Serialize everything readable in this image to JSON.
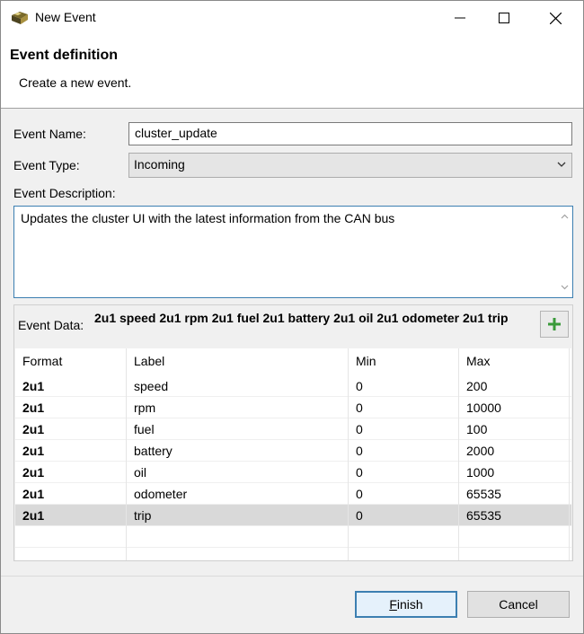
{
  "window": {
    "title": "New Event"
  },
  "banner": {
    "title": "Event definition",
    "description": "Create a new event."
  },
  "form": {
    "event_name_label": "Event Name:",
    "event_name_value": "cluster_update",
    "event_type_label": "Event Type:",
    "event_type_value": "Incoming",
    "event_description_label": "Event Description:",
    "event_description_value": "Updates the cluster UI with the latest information from the CAN bus"
  },
  "event_data": {
    "label": "Event Data:",
    "summary": "2u1 speed 2u1 rpm 2u1 fuel 2u1 battery 2u1 oil 2u1 odometer 2u1 trip",
    "columns": [
      "Format",
      "Label",
      "Min",
      "Max"
    ],
    "rows": [
      {
        "format": "2u1",
        "label": "speed",
        "min": "0",
        "max": "200"
      },
      {
        "format": "2u1",
        "label": "rpm",
        "min": "0",
        "max": "10000"
      },
      {
        "format": "2u1",
        "label": "fuel",
        "min": "0",
        "max": "100"
      },
      {
        "format": "2u1",
        "label": "battery",
        "min": "0",
        "max": "2000"
      },
      {
        "format": "2u1",
        "label": "oil",
        "min": "0",
        "max": "1000"
      },
      {
        "format": "2u1",
        "label": "odometer",
        "min": "0",
        "max": "65535"
      },
      {
        "format": "2u1",
        "label": "trip",
        "min": "0",
        "max": "65535"
      }
    ],
    "selected_row": "trip"
  },
  "buttons": {
    "finish_mnemonic": "F",
    "finish_rest": "inish",
    "cancel": "Cancel"
  },
  "icons": {
    "app": "event-wizard-icon",
    "add": "plus-icon"
  },
  "colors": {
    "accent": "#3c7fb1",
    "add_icon": "#3a9a3a",
    "selected_row": "#d9d9d9"
  }
}
